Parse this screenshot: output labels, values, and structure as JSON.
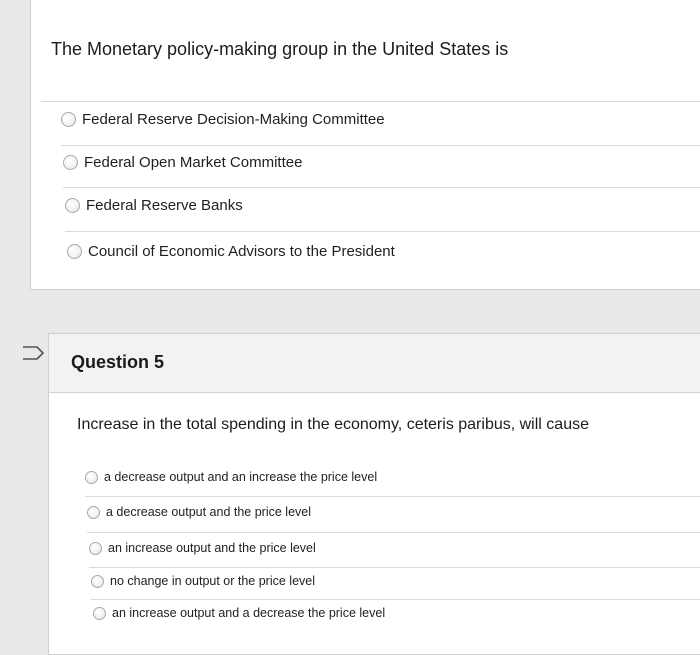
{
  "question4": {
    "prompt": "The Monetary policy-making group in the United States is",
    "options": [
      "Federal Reserve Decision-Making Committee",
      "Federal Open Market Committee",
      "Federal Reserve Banks",
      "Council of Economic Advisors to the President"
    ]
  },
  "question5": {
    "title": "Question 5",
    "prompt": "Increase in the total spending in the economy, ceteris paribus, will cause",
    "options": [
      "a decrease output and an increase the price level",
      "a decrease output and the price level",
      "an increase output and the price level",
      "no change in output or the price level",
      "an increase output and a decrease the price level"
    ]
  },
  "icons": {
    "flag": "flag-outline-icon"
  },
  "colors": {
    "page_background": "#e9e9ea",
    "card_background": "#ffffff",
    "header_background": "#f2f2f2"
  }
}
